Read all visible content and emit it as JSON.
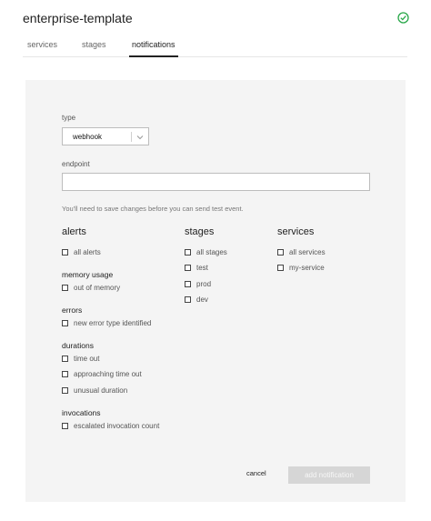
{
  "header": {
    "title": "enterprise-template",
    "status_icon": "check-circle-icon",
    "status_color": "#2aa84a"
  },
  "tabs": [
    {
      "label": "services",
      "active": false
    },
    {
      "label": "stages",
      "active": false
    },
    {
      "label": "notifications",
      "active": true
    }
  ],
  "form": {
    "type_label": "type",
    "type_value": "webhook",
    "endpoint_label": "endpoint",
    "endpoint_value": "",
    "hint": "You'll need to save changes before you can send test event."
  },
  "alerts": {
    "heading": "alerts",
    "all": "all alerts",
    "memory_heading": "memory usage",
    "memory_items": [
      "out of memory"
    ],
    "errors_heading": "errors",
    "errors_items": [
      "new error type identified"
    ],
    "durations_heading": "durations",
    "durations_items": [
      "time out",
      "approaching time out",
      "unusual duration"
    ],
    "invocations_heading": "invocations",
    "invocations_items": [
      "escalated invocation count"
    ]
  },
  "stages": {
    "heading": "stages",
    "items": [
      "all stages",
      "test",
      "prod",
      "dev"
    ]
  },
  "services": {
    "heading": "services",
    "items": [
      "all services",
      "my-service"
    ]
  },
  "actions": {
    "cancel": "cancel",
    "add": "add notification"
  }
}
